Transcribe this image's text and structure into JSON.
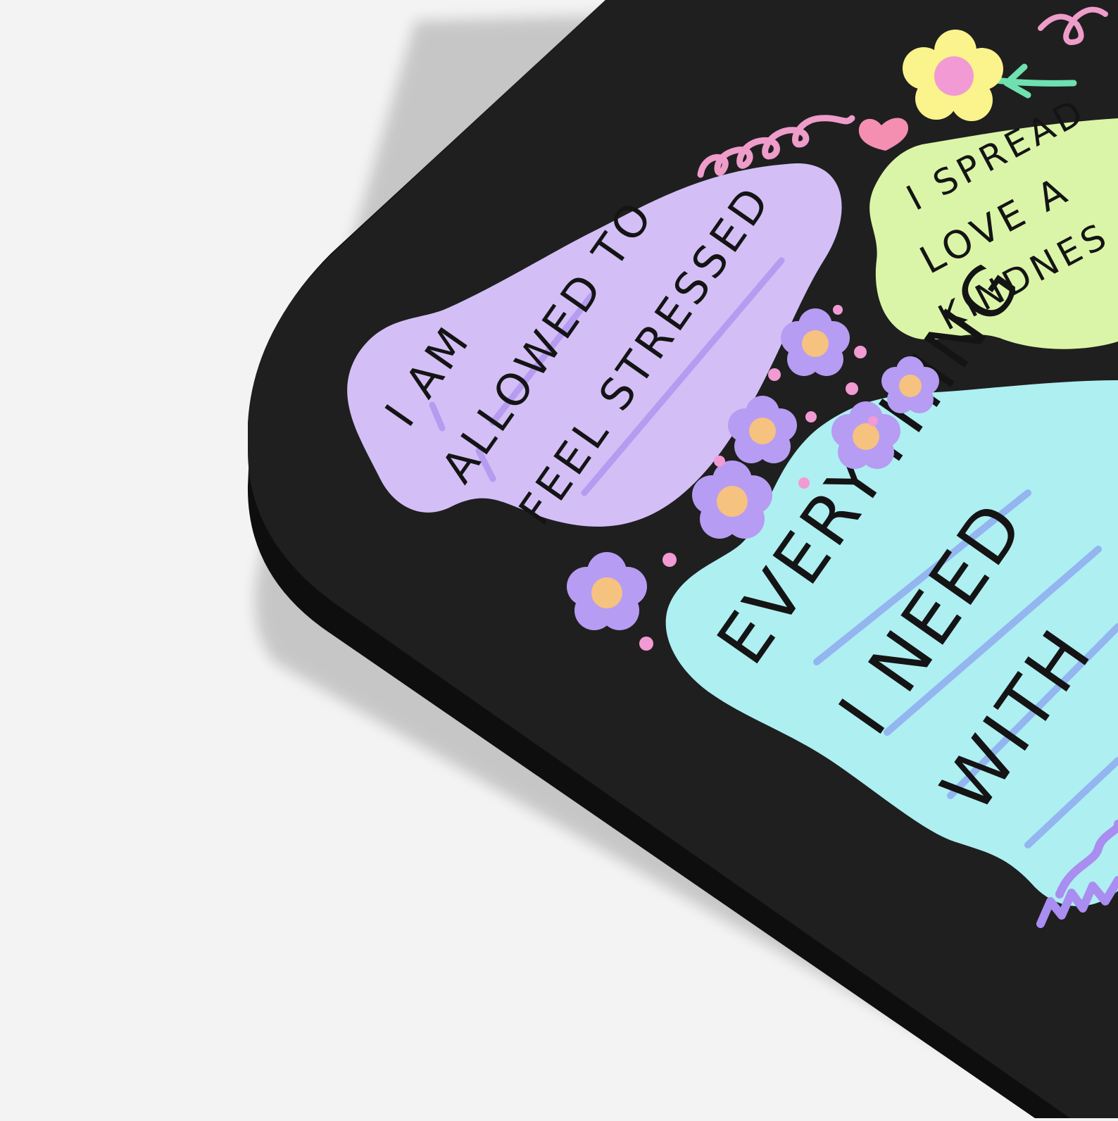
{
  "scene": {
    "subject": "mouse-pad-corner",
    "colors": {
      "background": "#f3f3f3",
      "pad_surface": "#1f1f1f",
      "pad_edge": "#0d0d0d",
      "lilac": "#d3bff6",
      "lilac_stroke": "#b59cf0",
      "mint": "#dbf5a8",
      "aqua": "#aeeff2",
      "aqua_stroke": "#93b5f0",
      "pink": "#f29ad3",
      "flower_petal": "#b69cf2",
      "flower_center": "#f6c27f",
      "yellow_flower": "#fbf38c",
      "stem": "#6fe0b0",
      "heart": "#f48fb1",
      "squiggle_pink": "#ee9cc9",
      "squiggle_purple": "#a98df0"
    }
  },
  "affirmations": {
    "lilac": [
      "I AM",
      "ALLOWED TO",
      "FEEL STRESSED"
    ],
    "mint": [
      "I SPREAD",
      "LOVE A",
      "KINDNES"
    ],
    "aqua": [
      "EVERYTHING",
      "I NEED",
      "WITH"
    ]
  },
  "icons": [
    "flower-icon",
    "heart-icon",
    "squiggle-icon"
  ]
}
